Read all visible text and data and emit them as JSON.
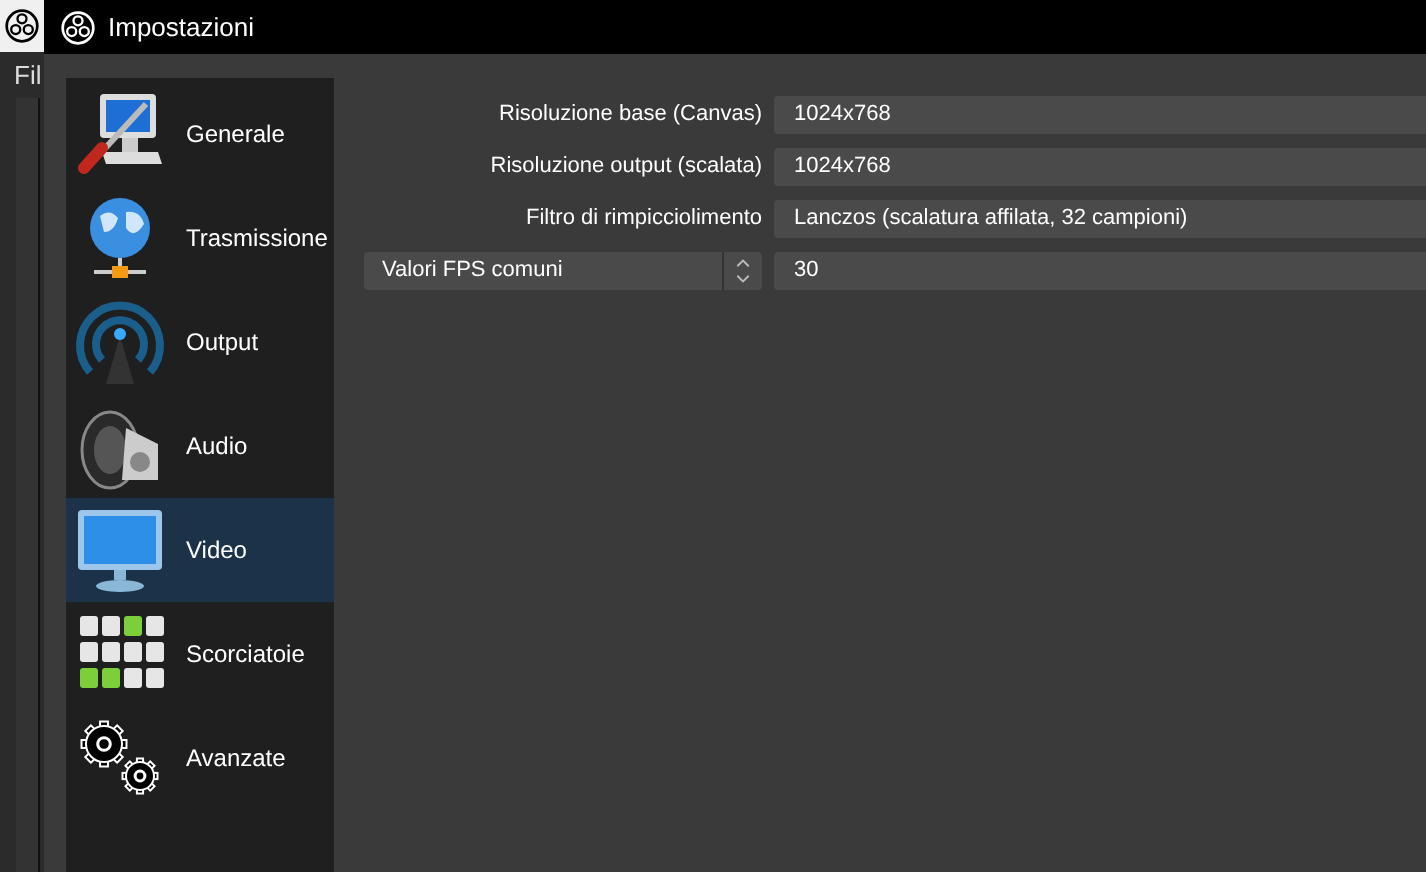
{
  "background_app": {
    "menu": "Fil"
  },
  "window": {
    "title": "Impostazioni"
  },
  "sidebar": {
    "items": [
      {
        "kind": "general",
        "label": "Generale",
        "selected": false
      },
      {
        "kind": "stream",
        "label": "Trasmissione",
        "selected": false
      },
      {
        "kind": "output",
        "label": "Output",
        "selected": false
      },
      {
        "kind": "audio",
        "label": "Audio",
        "selected": false
      },
      {
        "kind": "video",
        "label": "Video",
        "selected": true
      },
      {
        "kind": "hotkeys",
        "label": "Scorciatoie",
        "selected": false
      },
      {
        "kind": "advanced",
        "label": "Avanzate",
        "selected": false
      }
    ]
  },
  "form": {
    "rows": [
      {
        "kind": "label",
        "label": "Risoluzione base (Canvas)",
        "value": "1024x768"
      },
      {
        "kind": "label",
        "label": "Risoluzione output (scalata)",
        "value": "1024x768"
      },
      {
        "kind": "label",
        "label": "Filtro di rimpicciolimento",
        "value": "Lanczos (scalatura affilata, 32 campioni)"
      },
      {
        "kind": "selector",
        "label": "Valori FPS comuni",
        "value": "30"
      }
    ]
  }
}
